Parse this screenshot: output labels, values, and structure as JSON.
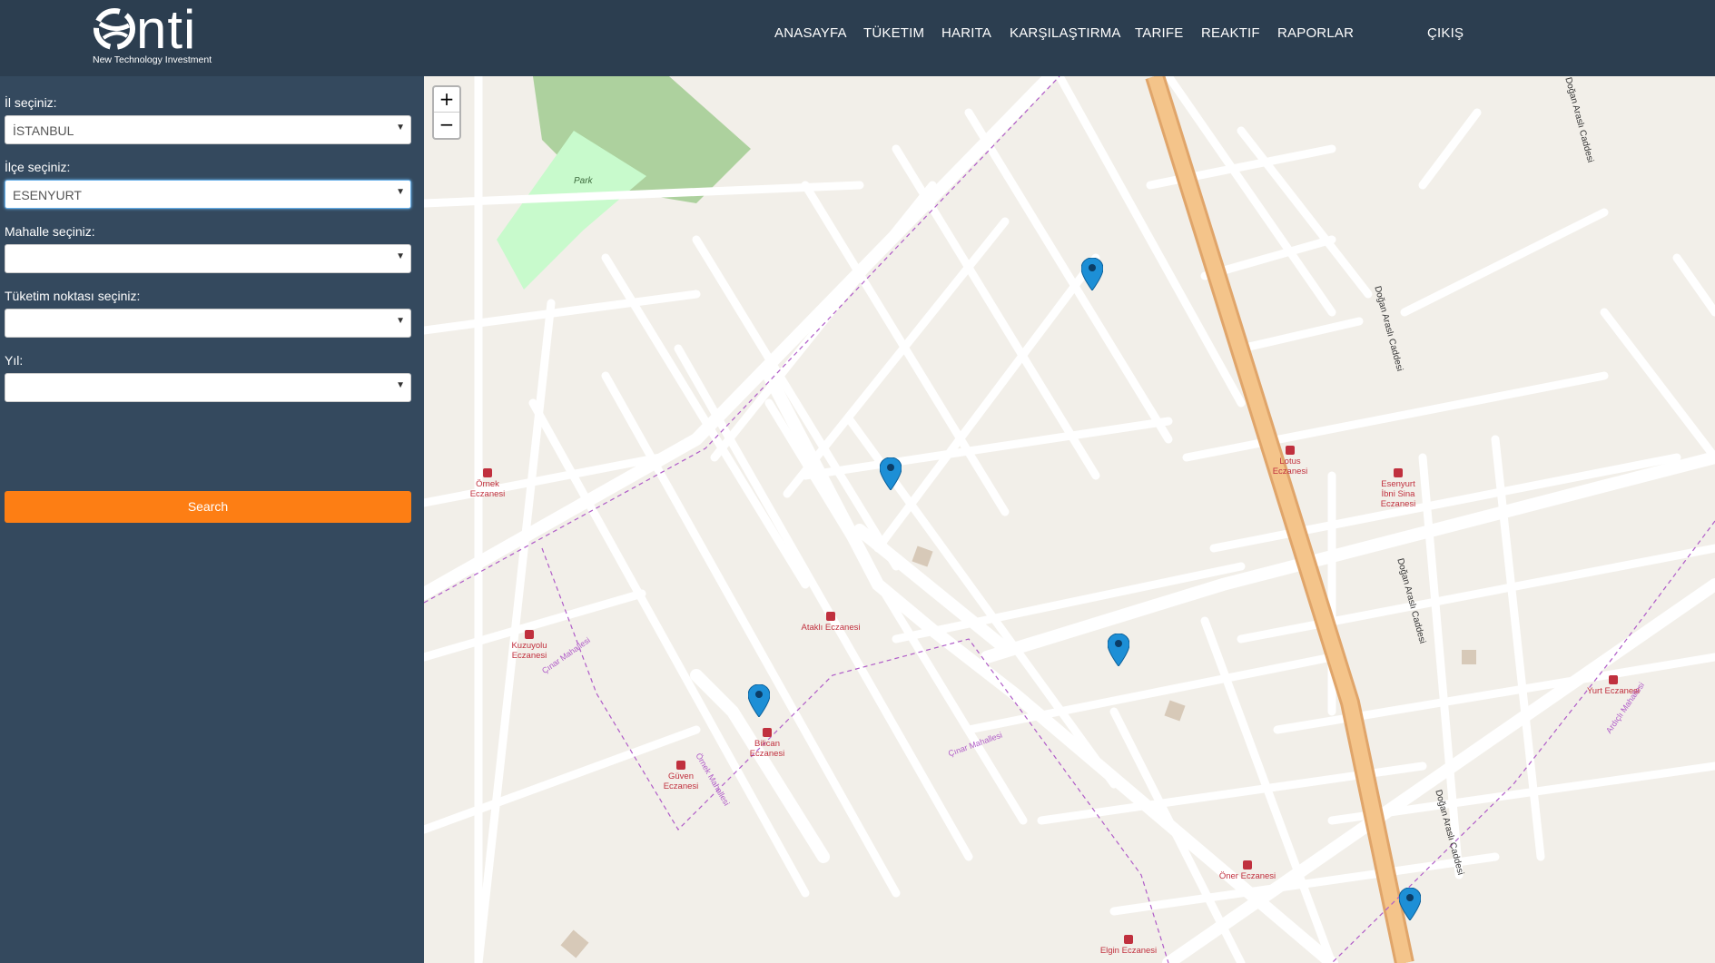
{
  "brand": {
    "name": "nti",
    "tagline": "New Technology Investment"
  },
  "nav": {
    "home": "ANASAYFA",
    "consumption": "TÜKETIM",
    "map": "HARITA",
    "compare": "KARŞILAŞTIRMA",
    "tariff": "TARIFE",
    "reactive": "REAKTIF",
    "reports": "RAPORLAR",
    "logout": "ÇIKIŞ"
  },
  "filters": {
    "province_label": "İl seçiniz:",
    "province_value": "İSTANBUL",
    "district_label": "İlçe seçiniz:",
    "district_value": "ESENYURT",
    "neighborhood_label": "Mahalle seçiniz:",
    "neighborhood_value": "",
    "point_label": "Tüketim noktası seçiniz:",
    "point_value": "",
    "year_label": "Yıl:",
    "year_value": "",
    "search_label": "Search"
  },
  "map": {
    "zoom_in": "+",
    "zoom_out": "−",
    "labels": {
      "park": "Park",
      "road_dogan": "Doğan Araslı Caddesi",
      "cinar": "Çınar Mahallesi",
      "ornek_mah": "Örnek Mahallesi",
      "ardicli": "Ardıçlı Mahallesi"
    },
    "pois": {
      "ornek": "Örnek Eczanesi",
      "kuzuyolu": "Kuzuyolu Eczanesi",
      "atakli": "Ataklı Eczanesi",
      "bilican": "Bilican Eczanesi",
      "guven": "Güven Eczanesi",
      "lotus": "Lotus Eczanesi",
      "esenyurt_ibni": "Esenyurt İbni Sina Eczanesi",
      "yurt": "Yurt Eczanesi",
      "oner": "Öner Eczanesi",
      "elgin": "Elgin Eczanesi"
    },
    "colors": {
      "pin": "#1d8fd6",
      "road_major": "#f4c48a",
      "park": "#c8facc",
      "forest": "#add19e",
      "pharmacy": "#c0303e"
    }
  }
}
